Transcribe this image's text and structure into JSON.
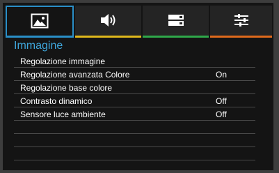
{
  "tabs": [
    {
      "icon": "image-icon",
      "color": "#2a8fc8",
      "selected": true
    },
    {
      "icon": "speaker-icon",
      "color": "#e0b81c",
      "selected": false
    },
    {
      "icon": "setup-icon",
      "color": "#2fa84a",
      "selected": false
    },
    {
      "icon": "adjust-sliders-icon",
      "color": "#e06a1c",
      "selected": false
    }
  ],
  "section_title": "Immagine",
  "menu_items": [
    {
      "label": "Regolazione immagine",
      "value": ""
    },
    {
      "label": "Regolazione avanzata Colore",
      "value": "On"
    },
    {
      "label": "Regolazione base colore",
      "value": ""
    },
    {
      "label": "Contrasto dinamico",
      "value": "Off"
    },
    {
      "label": "Sensore luce ambiente",
      "value": "Off"
    },
    {
      "label": "",
      "value": ""
    },
    {
      "label": "",
      "value": ""
    },
    {
      "label": "",
      "value": ""
    }
  ]
}
